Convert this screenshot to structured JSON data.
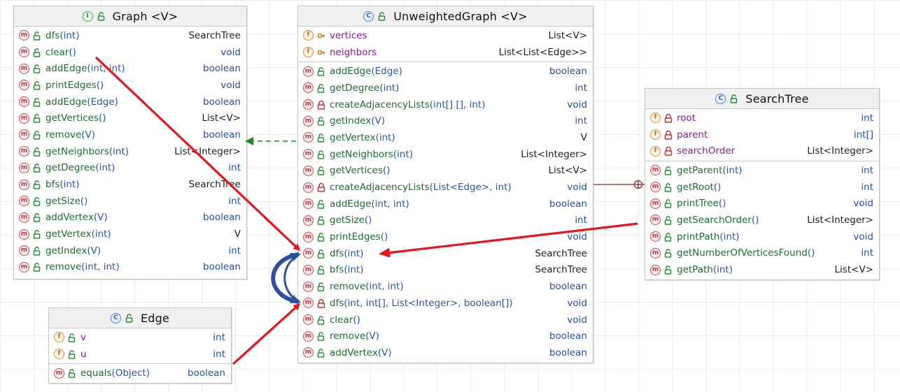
{
  "classes": {
    "graph": {
      "kind": "interface",
      "kind_letter": "I",
      "title": "Graph <V>",
      "sections": [
        [
          {
            "badge": "m",
            "vis": "public",
            "name": "dfs",
            "args": "(int)",
            "type": "SearchTree"
          },
          {
            "badge": "m",
            "vis": "public",
            "name": "clear",
            "args": "()",
            "type": "void"
          },
          {
            "badge": "m",
            "vis": "public",
            "name": "addEdge",
            "args": "(int, int)",
            "type": "boolean"
          },
          {
            "badge": "m",
            "vis": "public",
            "name": "printEdges",
            "args": "()",
            "type": "void"
          },
          {
            "badge": "m",
            "vis": "public",
            "name": "addEdge",
            "args": "(Edge)",
            "type": "boolean"
          },
          {
            "badge": "m",
            "vis": "public",
            "name": "getVertices",
            "args": "()",
            "type": "List<V>"
          },
          {
            "badge": "m",
            "vis": "public",
            "name": "remove",
            "args": "(V)",
            "type": "boolean"
          },
          {
            "badge": "m",
            "vis": "public",
            "name": "getNeighbors",
            "args": "(int)",
            "type": "List<Integer>"
          },
          {
            "badge": "m",
            "vis": "public",
            "name": "getDegree",
            "args": "(int)",
            "type": "int"
          },
          {
            "badge": "m",
            "vis": "public",
            "name": "bfs",
            "args": "(int)",
            "type": "SearchTree"
          },
          {
            "badge": "m",
            "vis": "public",
            "name": "getSize",
            "args": "()",
            "type": "int"
          },
          {
            "badge": "m",
            "vis": "public",
            "name": "addVertex",
            "args": "(V)",
            "type": "boolean"
          },
          {
            "badge": "m",
            "vis": "public",
            "name": "getVertex",
            "args": "(int)",
            "type": "V"
          },
          {
            "badge": "m",
            "vis": "public",
            "name": "getIndex",
            "args": "(V)",
            "type": "int"
          },
          {
            "badge": "m",
            "vis": "public",
            "name": "remove",
            "args": "(int, int)",
            "type": "boolean"
          }
        ]
      ]
    },
    "unweighted": {
      "kind": "class",
      "kind_letter": "C",
      "title": "UnweightedGraph <V>",
      "sections": [
        [
          {
            "badge": "f",
            "vis": "protected",
            "name": "vertices",
            "args": "",
            "type": "List<V>"
          },
          {
            "badge": "f",
            "vis": "protected",
            "name": "neighbors",
            "args": "",
            "type": "List<List<Edge>>"
          }
        ],
        [
          {
            "badge": "m",
            "vis": "public",
            "name": "addEdge",
            "args": "(Edge)",
            "type": "boolean"
          },
          {
            "badge": "m",
            "vis": "public",
            "name": "getDegree",
            "args": "(int)",
            "type": "int"
          },
          {
            "badge": "m",
            "vis": "private",
            "name": "createAdjacencyLists",
            "args": "(int[] [], int)",
            "type": "void"
          },
          {
            "badge": "m",
            "vis": "public",
            "name": "getIndex",
            "args": "(V)",
            "type": "int"
          },
          {
            "badge": "m",
            "vis": "public",
            "name": "getVertex",
            "args": "(int)",
            "type": "V"
          },
          {
            "badge": "m",
            "vis": "public",
            "name": "getNeighbors",
            "args": "(int)",
            "type": "List<Integer>"
          },
          {
            "badge": "m",
            "vis": "public",
            "name": "getVertices",
            "args": "()",
            "type": "List<V>"
          },
          {
            "badge": "m",
            "vis": "private",
            "name": "createAdjacencyLists",
            "args": "(List<Edge>, int)",
            "type": "void"
          },
          {
            "badge": "m",
            "vis": "public",
            "name": "addEdge",
            "args": "(int, int)",
            "type": "boolean"
          },
          {
            "badge": "m",
            "vis": "public",
            "name": "getSize",
            "args": "()",
            "type": "int"
          },
          {
            "badge": "m",
            "vis": "public",
            "name": "printEdges",
            "args": "()",
            "type": "void"
          },
          {
            "badge": "m",
            "vis": "public",
            "name": "dfs",
            "args": "(int)",
            "type": "SearchTree"
          },
          {
            "badge": "m",
            "vis": "public",
            "name": "bfs",
            "args": "(int)",
            "type": "SearchTree"
          },
          {
            "badge": "m",
            "vis": "public",
            "name": "remove",
            "args": "(int, int)",
            "type": "boolean"
          },
          {
            "badge": "m",
            "vis": "private",
            "name": "dfs",
            "args": "(int, int[], List<Integer>, boolean[])",
            "type": "void"
          },
          {
            "badge": "m",
            "vis": "public",
            "name": "clear",
            "args": "()",
            "type": "void"
          },
          {
            "badge": "m",
            "vis": "public",
            "name": "remove",
            "args": "(V)",
            "type": "boolean"
          },
          {
            "badge": "m",
            "vis": "public",
            "name": "addVertex",
            "args": "(V)",
            "type": "boolean"
          }
        ]
      ]
    },
    "searchtree": {
      "kind": "class",
      "kind_letter": "C",
      "title": "SearchTree",
      "sections": [
        [
          {
            "badge": "f",
            "vis": "private",
            "name": "root",
            "args": "",
            "type": "int"
          },
          {
            "badge": "f",
            "vis": "private",
            "name": "parent",
            "args": "",
            "type": "int[]"
          },
          {
            "badge": "f",
            "vis": "private",
            "name": "searchOrder",
            "args": "",
            "type": "List<Integer>"
          }
        ],
        [
          {
            "badge": "m",
            "vis": "public",
            "name": "getParent",
            "args": "(int)",
            "type": "int"
          },
          {
            "badge": "m",
            "vis": "public",
            "name": "getRoot",
            "args": "()",
            "type": "int"
          },
          {
            "badge": "m",
            "vis": "public",
            "name": "printTree",
            "args": "()",
            "type": "void"
          },
          {
            "badge": "m",
            "vis": "public",
            "name": "getSearchOrder",
            "args": "()",
            "type": "List<Integer>"
          },
          {
            "badge": "m",
            "vis": "public",
            "name": "printPath",
            "args": "(int)",
            "type": "void"
          },
          {
            "badge": "m",
            "vis": "public",
            "name": "getNumberOfVerticesFound",
            "args": "()",
            "type": "int"
          },
          {
            "badge": "m",
            "vis": "public",
            "name": "getPath",
            "args": "(int)",
            "type": "List<V>"
          }
        ]
      ]
    },
    "edge": {
      "kind": "class",
      "kind_letter": "C",
      "title": "Edge",
      "sections": [
        [
          {
            "badge": "f",
            "vis": "public",
            "name": "v",
            "args": "",
            "type": "int"
          },
          {
            "badge": "f",
            "vis": "public",
            "name": "u",
            "args": "",
            "type": "int"
          }
        ],
        [
          {
            "badge": "m",
            "vis": "public",
            "name": "equals",
            "args": "(Object)",
            "type": "boolean"
          }
        ]
      ]
    }
  },
  "colors": {
    "arrow_red": "#e8141c",
    "implements_green": "#1f8a2e",
    "recursion_blue": "#2f4fa0",
    "composition_line": "#8a2a2a"
  }
}
